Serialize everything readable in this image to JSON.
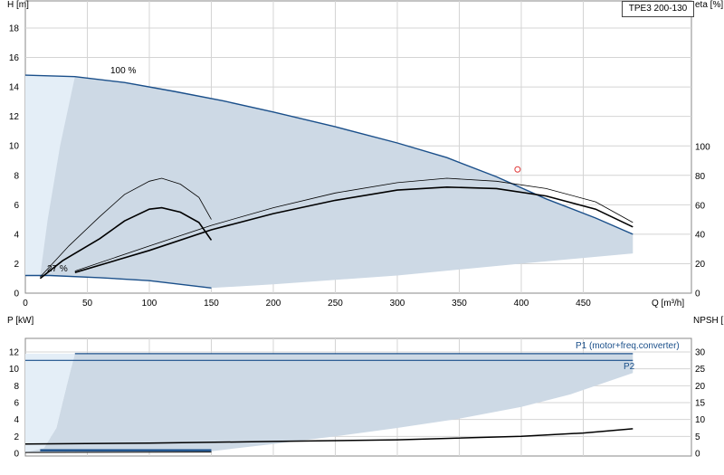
{
  "model": "TPE3 200-130",
  "chart_data": [
    {
      "type": "line",
      "title": "",
      "xlabel": "Q [m³/h]",
      "x_ticks": [
        0,
        50,
        100,
        150,
        200,
        250,
        300,
        350,
        400,
        450
      ],
      "xlim": [
        0,
        500
      ],
      "ylabel_left": "H [m]",
      "ylim_left": [
        0,
        19
      ],
      "yticks_left": [
        0,
        2,
        4,
        6,
        8,
        10,
        12,
        14,
        16,
        18
      ],
      "ylabel_right": "eta [%]",
      "ylim_right": [
        0,
        190
      ],
      "yticks_right": [
        0,
        20,
        40,
        60,
        80,
        100
      ],
      "grid": true,
      "annotations": [
        "100 %",
        "27 %"
      ],
      "colors": {
        "area": "#cdd9e5",
        "area_light": "#e4eef7",
        "curve": "#1a4f8a",
        "eff": "#000000",
        "duty_point": "#e03a3a"
      },
      "operating_area": {
        "upper_100pct": [
          [
            0,
            14.8
          ],
          [
            40,
            14.7
          ],
          [
            80,
            14.3
          ],
          [
            120,
            13.7
          ],
          [
            160,
            13.05
          ],
          [
            200,
            12.3
          ],
          [
            250,
            11.3
          ],
          [
            300,
            10.2
          ],
          [
            340,
            9.2
          ],
          [
            380,
            7.9
          ],
          [
            420,
            6.4
          ],
          [
            460,
            5.1
          ],
          [
            490,
            4.0
          ]
        ],
        "right_edge": [
          [
            490,
            4.0
          ],
          [
            490,
            2.7
          ]
        ],
        "bottom_edge": [
          [
            490,
            2.7
          ],
          [
            400,
            2.0
          ],
          [
            300,
            1.2
          ],
          [
            200,
            0.6
          ],
          [
            150,
            0.35
          ]
        ],
        "lower_27pct": [
          [
            150,
            0.35
          ],
          [
            100,
            0.85
          ],
          [
            60,
            1.05
          ],
          [
            20,
            1.2
          ],
          [
            0,
            1.2
          ]
        ]
      },
      "series": [
        {
          "name": "",
          "values": [
            [
              40,
              1.4
            ],
            [
              100,
              2.9
            ],
            [
              150,
              4.3
            ],
            [
              200,
              5.4
            ],
            [
              250,
              6.3
            ],
            [
              300,
              7.0
            ],
            [
              340,
              7.2
            ],
            [
              380,
              7.1
            ],
            [
              420,
              6.6
            ],
            [
              460,
              5.7
            ],
            [
              490,
              4.5
            ]
          ],
          "style": "thick"
        },
        {
          "name": "",
          "values": [
            [
              40,
              1.5
            ],
            [
              100,
              3.2
            ],
            [
              150,
              4.6
            ],
            [
              200,
              5.8
            ],
            [
              250,
              6.8
            ],
            [
              300,
              7.5
            ],
            [
              340,
              7.8
            ],
            [
              380,
              7.6
            ],
            [
              420,
              7.1
            ],
            [
              460,
              6.2
            ],
            [
              490,
              4.8
            ]
          ],
          "style": "thin"
        },
        {
          "name": "",
          "values": [
            [
              12,
              1.0
            ],
            [
              30,
              2.2
            ],
            [
              60,
              3.7
            ],
            [
              80,
              4.9
            ],
            [
              100,
              5.7
            ],
            [
              110,
              5.8
            ],
            [
              125,
              5.5
            ],
            [
              140,
              4.8
            ],
            [
              150,
              3.6
            ]
          ],
          "style": "thick"
        },
        {
          "name": "",
          "values": [
            [
              12,
              1.1
            ],
            [
              35,
              3.2
            ],
            [
              60,
              5.2
            ],
            [
              80,
              6.7
            ],
            [
              100,
              7.6
            ],
            [
              110,
              7.8
            ],
            [
              125,
              7.4
            ],
            [
              140,
              6.5
            ],
            [
              150,
              5.0
            ]
          ],
          "style": "thin"
        }
      ],
      "duty_point": [
        397,
        8.4
      ]
    },
    {
      "type": "line",
      "title": "",
      "xlabel": "",
      "xlim": [
        0,
        500
      ],
      "ylabel_left": "P [kW]",
      "ylim_left": [
        0,
        13.5
      ],
      "yticks_left": [
        0,
        2,
        4,
        6,
        8,
        10,
        12
      ],
      "ylabel_right": "NPSH [m]",
      "ylim_right": [
        0,
        33.75
      ],
      "yticks_right": [
        0,
        5,
        10,
        15,
        20,
        25,
        30
      ],
      "grid": true,
      "legend_labels": [
        "P1 (motor+freq.converter)",
        "P2"
      ],
      "operating_area": [
        [
          0,
          0.2
        ],
        [
          15,
          0.6
        ],
        [
          25,
          3.0
        ],
        [
          30,
          6.0
        ],
        [
          35,
          9.0
        ],
        [
          40,
          11.8
        ],
        [
          200,
          11.8
        ],
        [
          300,
          11.8
        ],
        [
          400,
          11.8
        ],
        [
          490,
          11.8
        ],
        [
          490,
          9.5
        ],
        [
          440,
          7.0
        ],
        [
          400,
          5.5
        ],
        [
          350,
          4.1
        ],
        [
          300,
          3.0
        ],
        [
          250,
          2.0
        ],
        [
          200,
          1.1
        ],
        [
          150,
          0.25
        ],
        [
          0,
          0.1
        ]
      ],
      "series": [
        {
          "name": "P1 (motor+freq.converter)",
          "values": [
            [
              40,
              11.8
            ],
            [
              490,
              11.8
            ]
          ]
        },
        {
          "name": "P2",
          "values": [
            [
              0,
              11.0
            ],
            [
              490,
              11.0
            ]
          ]
        },
        {
          "name": "",
          "values": [
            [
              0,
              1.1
            ],
            [
              100,
              1.2
            ],
            [
              200,
              1.4
            ],
            [
              300,
              1.6
            ],
            [
              400,
              2.0
            ],
            [
              450,
              2.4
            ],
            [
              490,
              2.9
            ]
          ],
          "style": "npsh"
        },
        {
          "name": "",
          "values": [
            [
              12,
              0.35
            ],
            [
              150,
              0.35
            ]
          ],
          "style": "bottom"
        },
        {
          "name": "",
          "values": [
            [
              0,
              0.1
            ],
            [
              150,
              0.15
            ]
          ],
          "style": "bottom-thin"
        }
      ]
    }
  ]
}
